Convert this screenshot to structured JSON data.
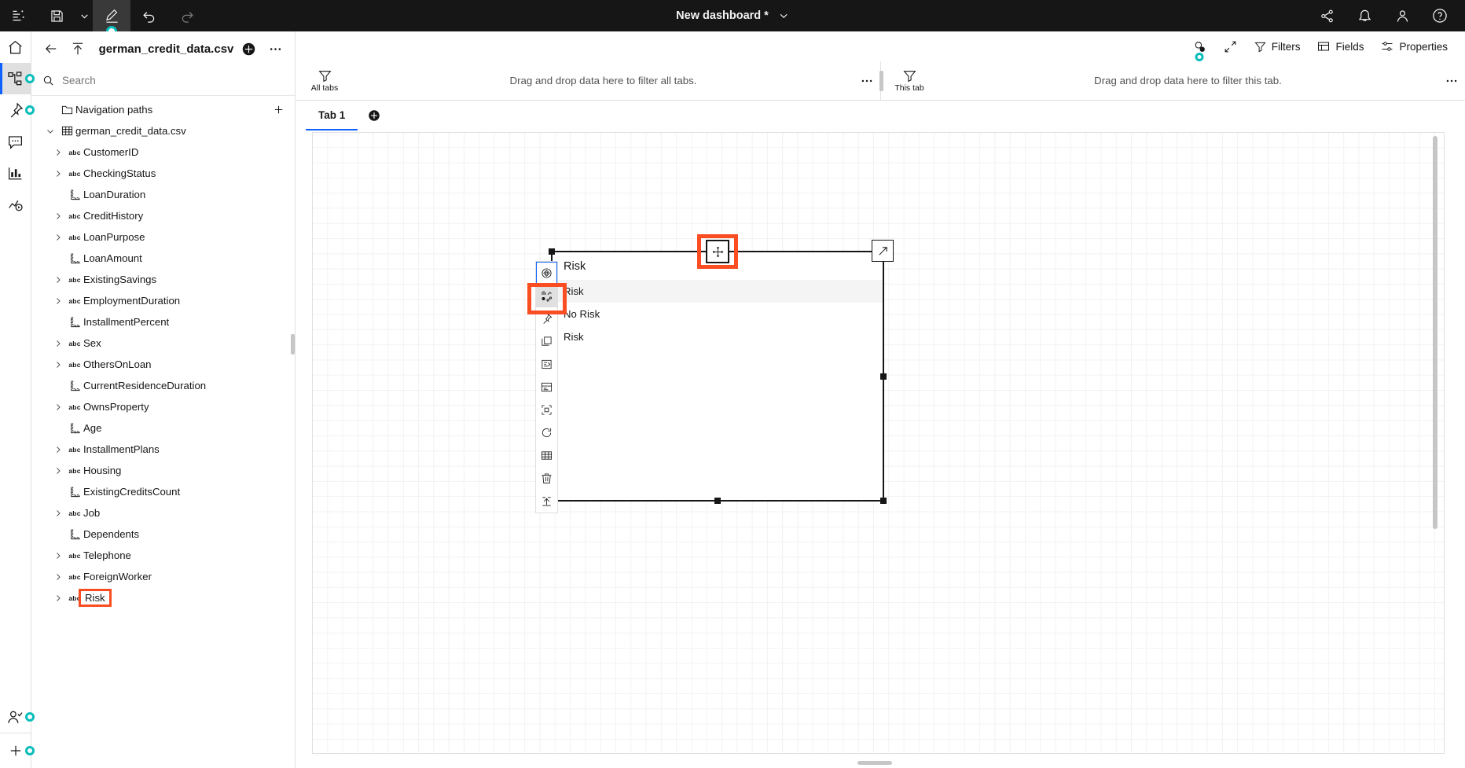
{
  "topbar": {
    "title": "New dashboard *",
    "left_buttons": [
      {
        "name": "outline-icon",
        "label": "Outline"
      },
      {
        "name": "save-icon",
        "label": "Save"
      },
      {
        "name": "save-caret-icon",
        "label": "Save options"
      },
      {
        "name": "edit-pencil-icon",
        "label": "Edit"
      },
      {
        "name": "undo-icon",
        "label": "Undo"
      },
      {
        "name": "redo-icon",
        "label": "Redo"
      }
    ],
    "right_buttons": [
      {
        "name": "share-icon",
        "label": "Share"
      },
      {
        "name": "notification-bell-icon",
        "label": "Notifications"
      },
      {
        "name": "user-avatar-icon",
        "label": "Account"
      },
      {
        "name": "help-icon",
        "label": "Help"
      }
    ]
  },
  "rail": {
    "items": [
      {
        "name": "home-icon",
        "label": "Home",
        "selected": false,
        "dot": false
      },
      {
        "name": "sources-icon",
        "label": "Sources",
        "selected": true,
        "dot": true
      },
      {
        "name": "pin-icon",
        "label": "Pinned",
        "selected": false,
        "dot": true
      },
      {
        "name": "comment-icon",
        "label": "Comments",
        "selected": false,
        "dot": false
      },
      {
        "name": "chart-icon",
        "label": "Visualizations",
        "selected": false,
        "dot": false
      },
      {
        "name": "insights-icon",
        "label": "Insights",
        "selected": false,
        "dot": false
      }
    ],
    "bottom": [
      {
        "name": "collaborate-icon",
        "label": "Collaborate",
        "dot": true
      },
      {
        "name": "add-icon",
        "label": "Add",
        "dot": true
      }
    ]
  },
  "panel": {
    "title": "german_credit_data.csv",
    "back_label": "Back",
    "upload_label": "Upload",
    "add_label": "Add source",
    "overflow_label": "More actions",
    "search_placeholder": "Search",
    "search_value": "",
    "tree": [
      {
        "label": "Navigation paths",
        "icon": "folder-icon",
        "indent": 1,
        "chevron": "none",
        "has_add": true,
        "highlight": false
      },
      {
        "label": "german_credit_data.csv",
        "icon": "table-icon",
        "indent": 1,
        "chevron": "down",
        "has_add": false,
        "highlight": false
      },
      {
        "label": "CustomerID",
        "icon": "abc-icon",
        "indent": 2,
        "chevron": "right",
        "has_add": false,
        "highlight": false
      },
      {
        "label": "CheckingStatus",
        "icon": "abc-icon",
        "indent": 2,
        "chevron": "right",
        "has_add": false,
        "highlight": false
      },
      {
        "label": "LoanDuration",
        "icon": "measure-icon",
        "indent": 2,
        "chevron": "none",
        "has_add": false,
        "highlight": false
      },
      {
        "label": "CreditHistory",
        "icon": "abc-icon",
        "indent": 2,
        "chevron": "right",
        "has_add": false,
        "highlight": false
      },
      {
        "label": "LoanPurpose",
        "icon": "abc-icon",
        "indent": 2,
        "chevron": "right",
        "has_add": false,
        "highlight": false
      },
      {
        "label": "LoanAmount",
        "icon": "measure-icon",
        "indent": 2,
        "chevron": "none",
        "has_add": false,
        "highlight": false
      },
      {
        "label": "ExistingSavings",
        "icon": "abc-icon",
        "indent": 2,
        "chevron": "right",
        "has_add": false,
        "highlight": false
      },
      {
        "label": "EmploymentDuration",
        "icon": "abc-icon",
        "indent": 2,
        "chevron": "right",
        "has_add": false,
        "highlight": false
      },
      {
        "label": "InstallmentPercent",
        "icon": "measure-icon",
        "indent": 2,
        "chevron": "none",
        "has_add": false,
        "highlight": false
      },
      {
        "label": "Sex",
        "icon": "abc-icon",
        "indent": 2,
        "chevron": "right",
        "has_add": false,
        "highlight": false
      },
      {
        "label": "OthersOnLoan",
        "icon": "abc-icon",
        "indent": 2,
        "chevron": "right",
        "has_add": false,
        "highlight": false
      },
      {
        "label": "CurrentResidenceDuration",
        "icon": "measure-icon",
        "indent": 2,
        "chevron": "none",
        "has_add": false,
        "highlight": false
      },
      {
        "label": "OwnsProperty",
        "icon": "abc-icon",
        "indent": 2,
        "chevron": "right",
        "has_add": false,
        "highlight": false
      },
      {
        "label": "Age",
        "icon": "measure-icon",
        "indent": 2,
        "chevron": "none",
        "has_add": false,
        "highlight": false
      },
      {
        "label": "InstallmentPlans",
        "icon": "abc-icon",
        "indent": 2,
        "chevron": "right",
        "has_add": false,
        "highlight": false
      },
      {
        "label": "Housing",
        "icon": "abc-icon",
        "indent": 2,
        "chevron": "right",
        "has_add": false,
        "highlight": false
      },
      {
        "label": "ExistingCreditsCount",
        "icon": "measure-icon",
        "indent": 2,
        "chevron": "none",
        "has_add": false,
        "highlight": false
      },
      {
        "label": "Job",
        "icon": "abc-icon",
        "indent": 2,
        "chevron": "right",
        "has_add": false,
        "highlight": false
      },
      {
        "label": "Dependents",
        "icon": "measure-icon",
        "indent": 2,
        "chevron": "none",
        "has_add": false,
        "highlight": false
      },
      {
        "label": "Telephone",
        "icon": "abc-icon",
        "indent": 2,
        "chevron": "right",
        "has_add": false,
        "highlight": false
      },
      {
        "label": "ForeignWorker",
        "icon": "abc-icon",
        "indent": 2,
        "chevron": "right",
        "has_add": false,
        "highlight": false
      },
      {
        "label": "Risk",
        "icon": "abc-icon",
        "indent": 2,
        "chevron": "right",
        "has_add": false,
        "highlight": true
      }
    ]
  },
  "dashboard": {
    "toolbar": [
      {
        "name": "search-data-icon",
        "label": "",
        "icon_only": true,
        "dot": true
      },
      {
        "name": "fullscreen-icon",
        "label": "",
        "icon_only": true,
        "dot": false
      },
      {
        "name": "filters-button",
        "label": "Filters",
        "icon_only": false,
        "dot": false
      },
      {
        "name": "fields-button",
        "label": "Fields",
        "icon_only": false,
        "dot": false
      },
      {
        "name": "properties-button",
        "label": "Properties",
        "icon_only": false,
        "dot": false
      }
    ],
    "filterbar": {
      "all_tabs_label": "All tabs",
      "all_tabs_drop": "Drag and drop data here to filter all tabs.",
      "this_tab_label": "This tab",
      "this_tab_drop": "Drag and drop data here to filter this tab.",
      "overflow_label": "•••"
    },
    "tabs": [
      {
        "label": "Tab 1",
        "active": true
      }
    ],
    "add_tab_label": "Add tab"
  },
  "widget": {
    "title": "Risk",
    "rows": [
      {
        "label": "Risk",
        "selected": true
      },
      {
        "label": "No Risk",
        "selected": false
      },
      {
        "label": "Risk",
        "selected": false
      }
    ],
    "move_handle_label": "Move widget",
    "expand_handle_label": "Expand widget"
  },
  "widget_toolbar": [
    {
      "name": "change-visualization-icon",
      "label": "Change visualization",
      "state": "focus"
    },
    {
      "name": "edit-visualization-icon",
      "label": "Edit visualization",
      "state": "selected"
    },
    {
      "name": "pin-widget-icon",
      "label": "Pin",
      "state": "none"
    },
    {
      "name": "copy-widget-icon",
      "label": "Copy",
      "state": "none"
    },
    {
      "name": "calculate-icon",
      "label": "Calculation",
      "state": "none"
    },
    {
      "name": "properties-widget-icon",
      "label": "Properties",
      "state": "none"
    },
    {
      "name": "format-icon",
      "label": "Format",
      "state": "none"
    },
    {
      "name": "reset-icon",
      "label": "Reset",
      "state": "none"
    },
    {
      "name": "grid-table-icon",
      "label": "Show data",
      "state": "none"
    },
    {
      "name": "delete-icon",
      "label": "Delete",
      "state": "none"
    },
    {
      "name": "ungroup-icon",
      "label": "Ungroup",
      "state": "none"
    }
  ],
  "colors": {
    "accent_blue": "#0f62fe",
    "highlight_orange": "#fa4d22",
    "teal_dot": "#08bdba",
    "dark_bar": "#161616"
  }
}
